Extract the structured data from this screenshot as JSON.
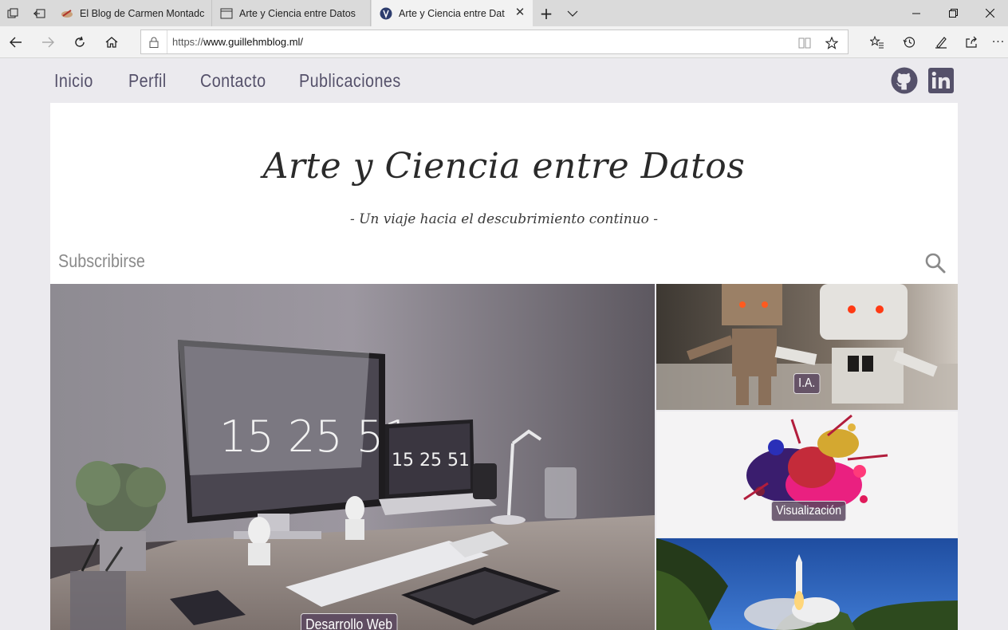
{
  "browser": {
    "tabs": [
      {
        "label": "El Blog de Carmen Montadc",
        "active": false
      },
      {
        "label": "Arte y Ciencia entre Datos",
        "active": false
      },
      {
        "label": "Arte y Ciencia entre Dat",
        "active": true
      }
    ],
    "url_prefix": "https://",
    "url_host": "www.guillehmblog.ml/"
  },
  "site": {
    "menu": [
      "Inicio",
      "Perfil",
      "Contacto",
      "Publicaciones"
    ],
    "title": "Arte y Ciencia entre Datos",
    "subtitle": "- Un viaje hacia el descubrimiento continuo -",
    "subscribe_label": "Subscribirse",
    "tiles": [
      {
        "label": "Desarrollo Web",
        "clock_big": "15 25 51",
        "clock_small": "15 25 51"
      },
      {
        "label": "I.A."
      },
      {
        "label": "Visualización"
      }
    ]
  },
  "colors": {
    "menu_text": "#55516a",
    "page_bg": "#ebeaee",
    "label_bg": "#5a465f"
  },
  "icons": [
    "github-icon",
    "linkedin-icon",
    "search-icon"
  ]
}
